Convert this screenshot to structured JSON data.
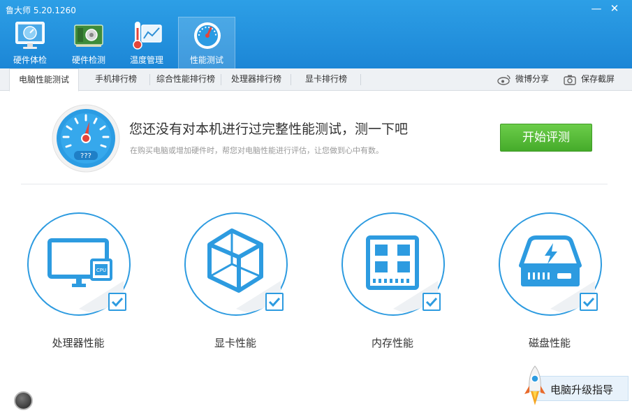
{
  "window": {
    "title": "鲁大师 5.20.1260",
    "minimize_glyph": "—",
    "close_glyph": "✕"
  },
  "nav_tabs": [
    {
      "label": "硬件体检",
      "icon": "monitor-clock-icon"
    },
    {
      "label": "硬件检测",
      "icon": "circuit-board-icon"
    },
    {
      "label": "温度管理",
      "icon": "thermometer-icon"
    },
    {
      "label": "性能测试",
      "icon": "speedometer-icon",
      "active": true
    }
  ],
  "sub_tabs": [
    {
      "label": "电脑性能测试",
      "active": true
    },
    {
      "label": "手机排行榜"
    },
    {
      "label": "综合性能排行榜"
    },
    {
      "label": "处理器排行榜"
    },
    {
      "label": "显卡排行榜"
    }
  ],
  "toolbar": {
    "weibo_share": "微博分享",
    "save_screenshot": "保存截屏"
  },
  "hero": {
    "gauge_value": "???",
    "title": "您还没有对本机进行过完整性能测试，测一下吧",
    "subtitle": "在购买电脑或增加硬件时，帮您对电脑性能进行评估，让您做到心中有数。",
    "start_button": "开始评测"
  },
  "test_items": [
    {
      "label": "处理器性能",
      "icon": "monitor-cpu-icon",
      "checked": true,
      "cpu_chip_text": "CPU"
    },
    {
      "label": "显卡性能",
      "icon": "cube-icon",
      "checked": true
    },
    {
      "label": "内存性能",
      "icon": "memory-chip-icon",
      "checked": true
    },
    {
      "label": "磁盘性能",
      "icon": "disk-drive-icon",
      "checked": true
    }
  ],
  "upgrade_guide": {
    "label": "电脑升级指导"
  },
  "colors": {
    "accent_blue": "#2d9be0",
    "titlebar_blue": "#1c86d6",
    "start_green": "#45ab2a"
  }
}
